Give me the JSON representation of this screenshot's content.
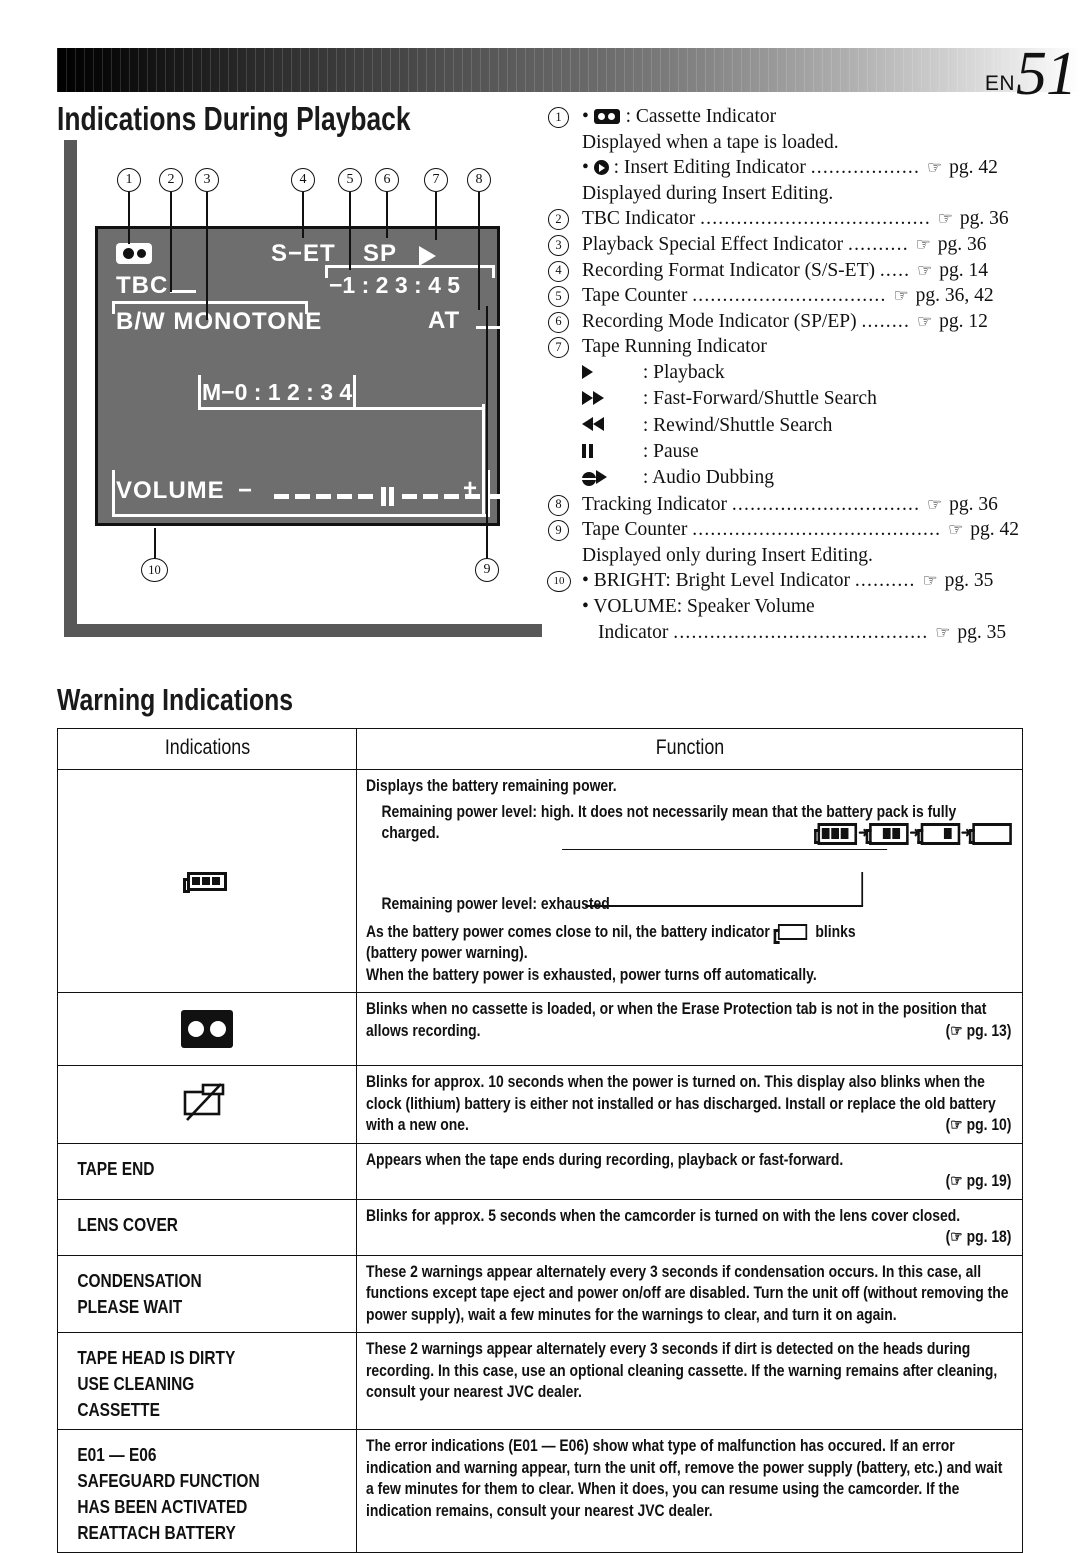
{
  "header": {
    "lang": "EN",
    "page": "51"
  },
  "sections": {
    "playback_title": "Indications During Playback",
    "warning_title": "Warning Indications"
  },
  "lcd": {
    "cassette_icon": "cassette-icon",
    "tbc": "TBC",
    "effect": "B/W  MONOTONE",
    "format": "S−ET",
    "rec_mode": "SP",
    "running_icon": "play-triangle-icon",
    "counter_main": "−1 : 2 3 : 4 5",
    "tracking": "AT",
    "counter_insert": "M−0 : 1 2 : 3 4",
    "volume_label": "VOLUME",
    "volume_minus": "−",
    "volume_plus": "+",
    "callouts": [
      "1",
      "2",
      "3",
      "4",
      "5",
      "6",
      "7",
      "8",
      "9",
      "10"
    ]
  },
  "legend": [
    {
      "num": "1",
      "type": "bullet-icon",
      "icon": "cassette-icon",
      "text": ": Cassette Indicator",
      "sub": "Displayed when a tape is loaded."
    },
    {
      "num": "",
      "type": "bullet-icon",
      "icon": "insert-edit-icon",
      "text": ": Insert Editing Indicator",
      "dots": "..................",
      "pg": "pg. 42",
      "sub": "Displayed during Insert Editing."
    },
    {
      "num": "2",
      "type": "plain",
      "text": "TBC Indicator",
      "dots": "......................................",
      "pg": "pg. 36"
    },
    {
      "num": "3",
      "type": "plain",
      "text": "Playback Special Effect Indicator",
      "dots": "..........",
      "pg": "pg. 36"
    },
    {
      "num": "4",
      "type": "plain",
      "text": "Recording Format Indicator (S/S-ET)",
      "dots": ".....",
      "pg": "pg. 14"
    },
    {
      "num": "5",
      "type": "plain",
      "text": "Tape Counter",
      "dots": "................................",
      "pg": "pg. 36, 42"
    },
    {
      "num": "6",
      "type": "plain",
      "text": "Recording Mode Indicator (SP/EP)",
      "dots": "........",
      "pg": "pg. 12"
    },
    {
      "num": "7",
      "type": "plain",
      "text": "Tape Running Indicator"
    }
  ],
  "running_modes": [
    {
      "icon": "play-icon",
      "label": ": Playback"
    },
    {
      "icon": "fast-forward-icon",
      "label": ": Fast-Forward/Shuttle Search"
    },
    {
      "icon": "rewind-icon",
      "label": ": Rewind/Shuttle Search"
    },
    {
      "icon": "pause-icon",
      "label": ": Pause"
    },
    {
      "icon": "audio-dub-icon",
      "label": ": Audio Dubbing"
    }
  ],
  "legend_tail": [
    {
      "num": "8",
      "text": "Tracking Indicator",
      "dots": "...............................",
      "pg": "pg. 36"
    },
    {
      "num": "9",
      "text": "Tape Counter",
      "dots": ".........................................",
      "pg": "pg. 42",
      "sub": "Displayed only during Insert Editing."
    },
    {
      "num": "10",
      "text": "• BRIGHT: Bright Level Indicator",
      "dots": "..........",
      "pg": "pg. 35"
    },
    {
      "num": "",
      "text": "• VOLUME: Speaker Volume",
      "sub2": "Indicator",
      "dots2": "..........................................",
      "pg2": "pg. 35"
    }
  ],
  "table": {
    "head_indications": "Indications",
    "head_function": "Function",
    "rows": [
      {
        "icon": "battery-full-icon",
        "label": "",
        "lines": [
          "Displays the battery remaining power.",
          "Remaining power level: high. It does not necessarily mean that the battery pack is fully charged.",
          "Remaining power level: exhausted",
          "As the battery power comes close to nil, the battery indicator",
          "blinks (battery power warning).",
          "When the battery power is exhausted, power turns off automatically."
        ]
      },
      {
        "icon": "cassette-warning-icon",
        "label": "",
        "text": "Blinks when no cassette is loaded, or when the Erase Protection tab is not in the position that allows recording.",
        "pg": "(☞ pg. 13)"
      },
      {
        "icon": "clock-battery-icon",
        "label": "",
        "text": "Blinks for approx. 10 seconds when the power is turned on. This display also blinks when the clock (lithium) battery is either not installed or has discharged. Install or replace the old battery with a new one.",
        "pg": "(☞ pg. 10)"
      },
      {
        "icon": "",
        "label": "TAPE END",
        "text": "Appears when the tape ends during recording, playback or fast-forward.",
        "pg": "(☞ pg. 19)"
      },
      {
        "icon": "",
        "label": "LENS COVER",
        "text": "Blinks for approx. 5 seconds when the camcorder is turned on with the lens cover closed.",
        "pg": "(☞ pg. 18)"
      },
      {
        "icon": "",
        "label": "CONDENSATION\nPLEASE WAIT",
        "text": "These 2 warnings appear alternately every 3 seconds if condensation occurs. In this case, all functions except tape eject and power on/off are disabled. Turn the unit off (without removing the power supply), wait a few minutes for the warnings to clear, and turn it on again.",
        "pg": ""
      },
      {
        "icon": "",
        "label": "TAPE HEAD IS DIRTY\nUSE CLEANING\n   CASSETTE",
        "text": "These 2 warnings appear alternately every 3 seconds if dirt is detected on the heads during recording. In this case, use an optional cleaning cassette. If the warning remains after cleaning, consult your nearest JVC dealer.",
        "pg": ""
      },
      {
        "icon": "",
        "label": "E01 — E06\nSAFEGUARD FUNCTION\nHAS BEEN ACTIVATED\nREATTACH BATTERY",
        "text": "The error indications (E01 — E06) show what type of malfunction has occured. If an error indication and warning appear, turn the unit off, remove the power supply (battery, etc.) and wait a few minutes for them to clear. When it does, you can resume using the camcorder. If the indication remains, consult your nearest JVC dealer.",
        "pg": ""
      }
    ]
  }
}
